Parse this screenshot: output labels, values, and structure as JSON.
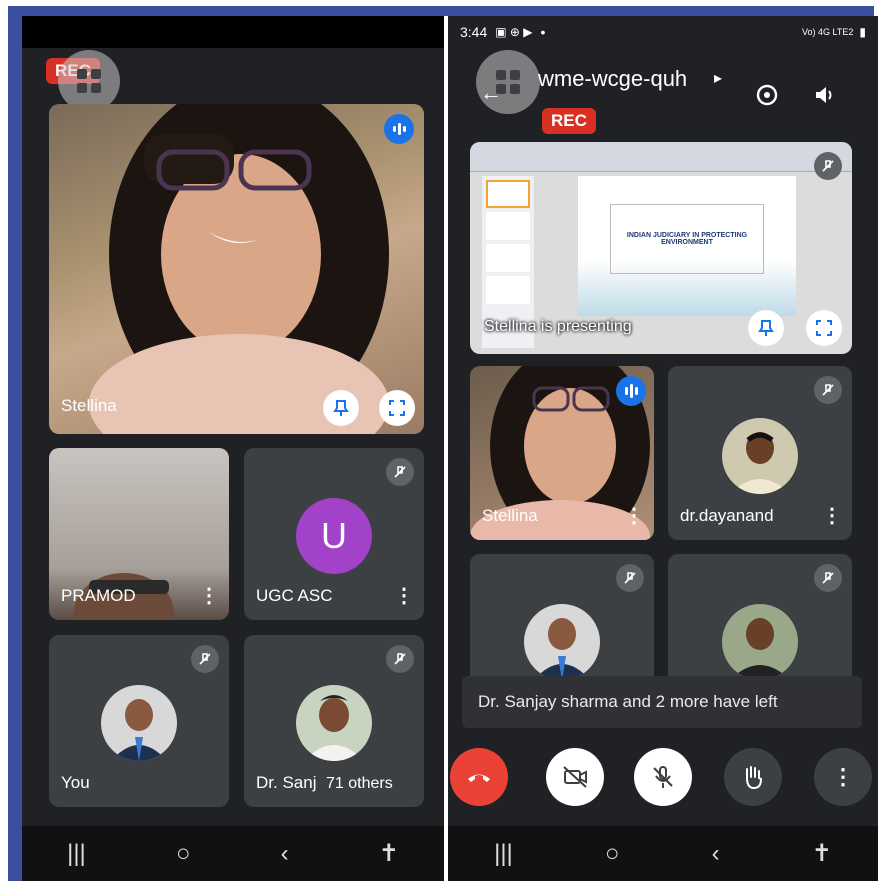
{
  "left": {
    "rec_label": "REC",
    "main_tile": {
      "name": "Stellina"
    },
    "tiles": [
      {
        "name": "PRAMOD"
      },
      {
        "name": "UGC ASC",
        "initial": "U"
      },
      {
        "name": "You"
      },
      {
        "name": "Dr. Sanj",
        "others_label": "71 others"
      }
    ]
  },
  "right": {
    "status": {
      "time": "3:44",
      "network": "Vo) 4G LTE2",
      "dot": "•"
    },
    "meeting_code": "wme-wcge-quh",
    "rec_label": "REC",
    "presentation": {
      "slide_title": "INDIAN JUDICIARY IN PROTECTING ENVIRONMENT",
      "presenting_label": "Stellina is presenting"
    },
    "tiles": [
      {
        "name": "Stellina"
      },
      {
        "name": "dr.dayanand"
      }
    ],
    "toast": "Dr. Sanjay sharma and 2 more have left"
  },
  "colors": {
    "background": "#202124",
    "tile": "#3c4043",
    "rec": "#d93025",
    "speaking": "#1a73e8",
    "avatar_purple": "#a142c8",
    "end_call": "#ea4335",
    "frame_blue": "#3a4fa0"
  }
}
